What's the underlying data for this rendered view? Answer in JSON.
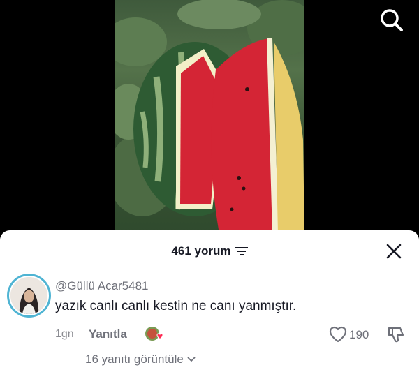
{
  "comments_sheet": {
    "count_label": "461 yorum"
  },
  "comment": {
    "username": "@Güllü Acar5481",
    "text": "yazık canlı canlı kestin ne canı yanmıştır.",
    "time": "1gn",
    "reply_label": "Yanıtla",
    "like_count": "190",
    "view_replies_label": "16 yanıtı görüntüle"
  },
  "colors": {
    "avatar_ring": "#4fb4d3",
    "heart_badge": "#fe2c55"
  },
  "icons": [
    "search-icon",
    "sort-icon",
    "close-icon",
    "heart-icon",
    "dislike-icon",
    "chevron-down-icon"
  ]
}
